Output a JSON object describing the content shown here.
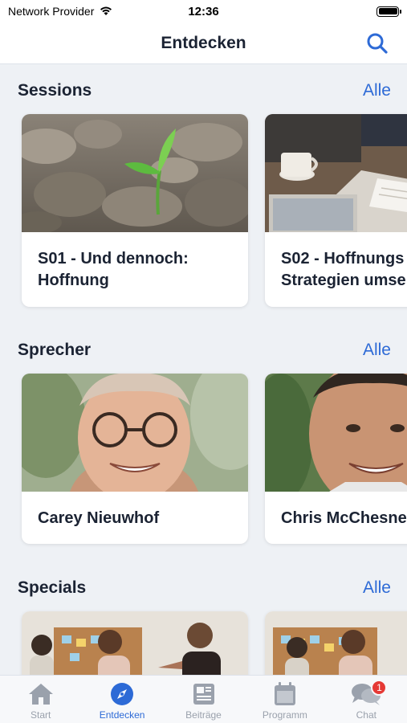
{
  "status_bar": {
    "carrier": "Network Provider",
    "time": "12:36"
  },
  "nav": {
    "title": "Entdecken",
    "search_icon": "search-icon"
  },
  "sections": [
    {
      "title": "Sessions",
      "all_label": "Alle",
      "cards": [
        {
          "title_line1": "S01 - Und dennoch:",
          "title_line2": "Hoffnung",
          "image": "sprout-in-soil-photo"
        },
        {
          "title_line1": "S02 - Hoffnungs",
          "title_line2": "Strategien umse",
          "image": "desk-notebook-coffee-photo"
        }
      ]
    },
    {
      "title": "Sprecher",
      "all_label": "Alle",
      "cards": [
        {
          "name": "Carey Nieuwhof",
          "image": "smiling-man-glasses-photo"
        },
        {
          "name": "Chris McChesne",
          "image": "smiling-man-photo"
        }
      ]
    },
    {
      "title": "Specials",
      "all_label": "Alle",
      "cards": [
        {
          "image": "team-meeting-photo"
        },
        {
          "image": "team-meeting-photo"
        }
      ]
    }
  ],
  "tabbar": {
    "items": [
      {
        "label": "Start",
        "icon": "home-icon",
        "active": false
      },
      {
        "label": "Entdecken",
        "icon": "compass-icon",
        "active": true
      },
      {
        "label": "Beiträge",
        "icon": "newspaper-icon",
        "active": false
      },
      {
        "label": "Programm",
        "icon": "calendar-icon",
        "active": false
      },
      {
        "label": "Chat",
        "icon": "chat-icon",
        "active": false,
        "badge": "1"
      }
    ]
  },
  "colors": {
    "accent": "#2d6ad6",
    "background": "#eef1f5",
    "badge": "#e53935",
    "inactive_tab": "#9aa1ac"
  }
}
